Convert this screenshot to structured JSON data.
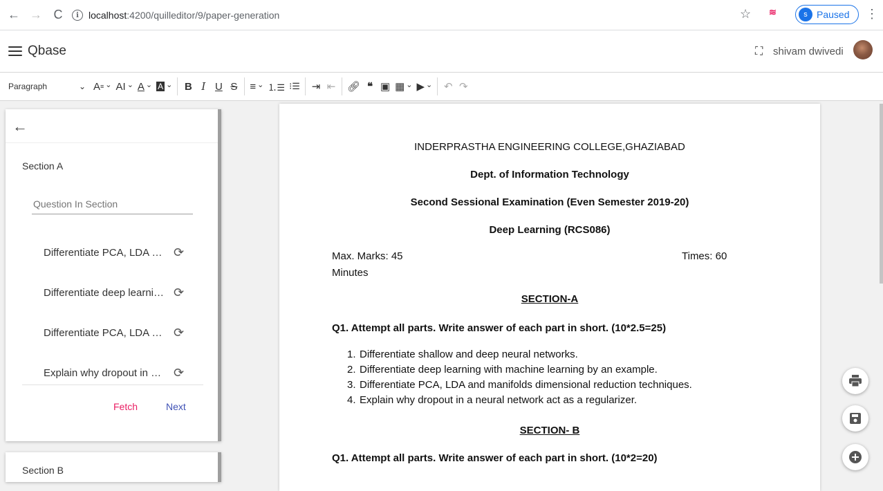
{
  "browser": {
    "url_host": "localhost",
    "url_path": ":4200/quilleditor/9/paper-generation",
    "profile_initial": "s",
    "profile_status": "Paused"
  },
  "app": {
    "title": "Qbase",
    "user_name": "shivam dwivedi"
  },
  "toolbar": {
    "paragraph_label": "Paragraph"
  },
  "sidebar": {
    "section_a_title": "Section A",
    "question_input_placeholder": "Question In Section",
    "questions": [
      {
        "text": "Differentiate PCA, LDA and manifolds dimensional reduction techniques."
      },
      {
        "text": "Differentiate deep learning with machine learning by an example."
      },
      {
        "text": "Differentiate PCA, LDA and manifolds dimensional reduction techniques."
      },
      {
        "text": "Explain why dropout in a neural network act as a regularizer."
      }
    ],
    "fetch_label": "Fetch",
    "next_label": "Next",
    "section_b_title": "Section B"
  },
  "document": {
    "college": "INDERPRASTHA ENGINEERING COLLEGE,GHAZIABAD",
    "dept": "Dept. of Information Technology",
    "exam": "Second Sessional Examination (Even Semester 2019-20)",
    "subject": "Deep Learning (RCS086)",
    "max_marks": "Max. Marks: 45",
    "times": "Times: 60",
    "minutes": "Minutes",
    "section_a_heading": "SECTION-A",
    "section_a_q1": "Q1. Attempt all parts. Write answer of each part in short. (10*2.5=25)",
    "section_a_items": [
      {
        "num": "1.",
        "text": "Differentiate shallow and deep neural networks."
      },
      {
        "num": "2.",
        "text": "Differentiate deep learning with machine learning by an example."
      },
      {
        "num": "3.",
        "text": "Differentiate PCA, LDA and manifolds dimensional reduction techniques."
      },
      {
        "num": "4.",
        "text": "Explain why dropout in a neural network act as a regularizer."
      }
    ],
    "section_b_heading": "SECTION- B",
    "section_b_q1": "Q1. Attempt all parts. Write answer of each part in short. (10*2=20)"
  }
}
